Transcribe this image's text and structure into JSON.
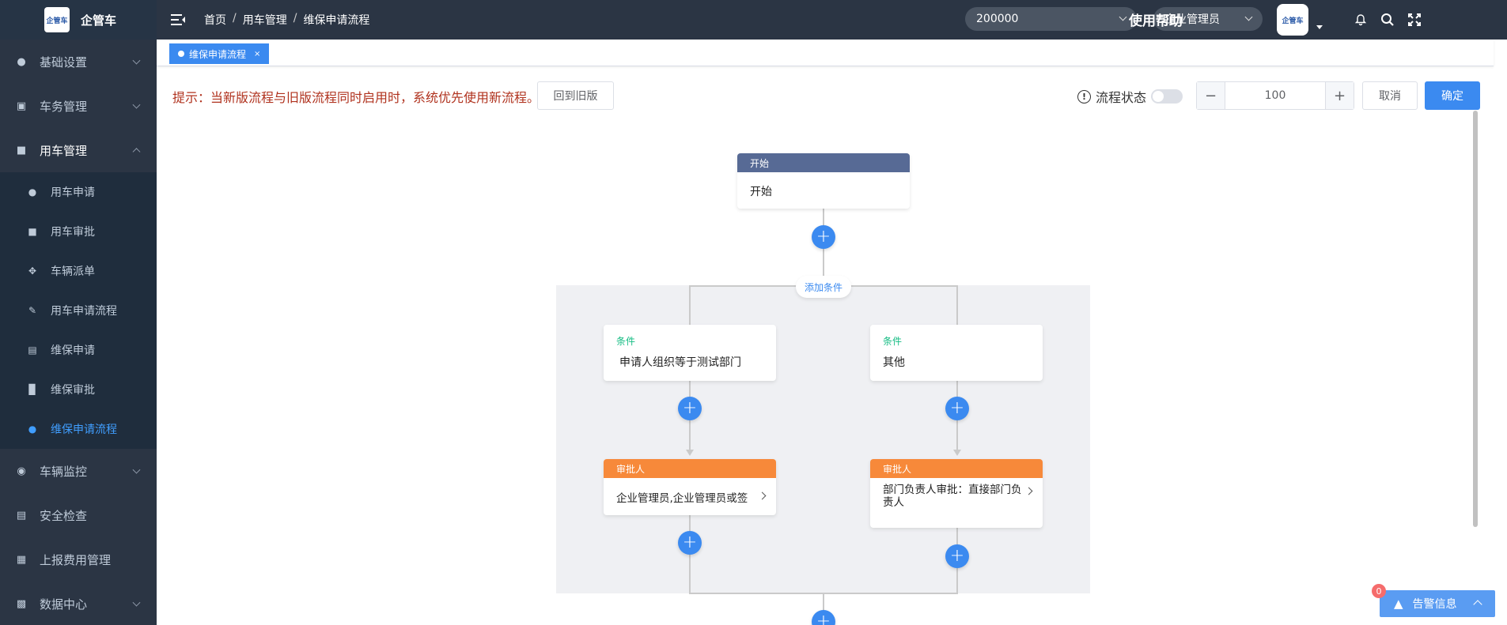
{
  "app": {
    "logo_text": "企管车",
    "logo_mark": "企管车"
  },
  "sidebar": {
    "items": [
      {
        "label": "基础设置",
        "icon": "users-icon"
      },
      {
        "label": "车务管理",
        "icon": "monitor-icon"
      },
      {
        "label": "用车管理",
        "icon": "document-icon",
        "expanded": true
      }
    ],
    "submenu": [
      {
        "label": "用车申请",
        "icon": "user-icon"
      },
      {
        "label": "用车审批",
        "icon": "file-icon"
      },
      {
        "label": "车辆派单",
        "icon": "move-icon"
      },
      {
        "label": "用车申请流程",
        "icon": "edit-icon"
      },
      {
        "label": "维保申请",
        "icon": "file-text-icon"
      },
      {
        "label": "维保审批",
        "icon": "bar-chart-icon"
      },
      {
        "label": "维保申请流程",
        "icon": "people-icon",
        "active": true
      }
    ],
    "bottom_items": [
      {
        "label": "车辆监控",
        "icon": "globe-icon"
      },
      {
        "label": "安全检查",
        "icon": "keyboard-icon"
      },
      {
        "label": "上报费用管理",
        "icon": "grid-icon"
      },
      {
        "label": "数据中心",
        "icon": "lock-icon"
      }
    ]
  },
  "header": {
    "breadcrumb": [
      "首页",
      "用车管理",
      "维保申请流程"
    ],
    "org_select": "200000",
    "role_select": "企业管理员",
    "help": "使用帮助",
    "avatar_text": "企管车"
  },
  "tabs": [
    {
      "label": "维保申请流程",
      "close": "×"
    }
  ],
  "toolbar": {
    "tip": "提示：当新版流程与旧版流程同时启用时，系统优先使用新流程。",
    "back_old": "回到旧版",
    "status_label": "流程状态",
    "warn_glyph": "!",
    "zoom_value": "100",
    "zoom_minus": "−",
    "zoom_plus": "+",
    "cancel": "取消",
    "confirm": "确定"
  },
  "flow": {
    "start": {
      "head": "开始",
      "body": "开始"
    },
    "add_condition": "添加条件",
    "plus": "+",
    "branches": [
      {
        "cond_label": "条件",
        "cond_text": "申请人组织等于测试部门",
        "approver_head": "审批人",
        "approver_text": "企业管理员,企业管理员或签"
      },
      {
        "cond_label": "条件",
        "cond_text": "其他",
        "approver_head": "审批人",
        "approver_text": "部门负责人审批：直接部门负责人"
      }
    ]
  },
  "alert": {
    "label": "告警信息",
    "count": "0"
  },
  "colors": {
    "sidebar_bg": "#2b3544",
    "primary": "#3b8af0",
    "approver": "#f7893a",
    "start": "#576a95",
    "condition": "#15bc83",
    "tip": "#b0321e"
  }
}
